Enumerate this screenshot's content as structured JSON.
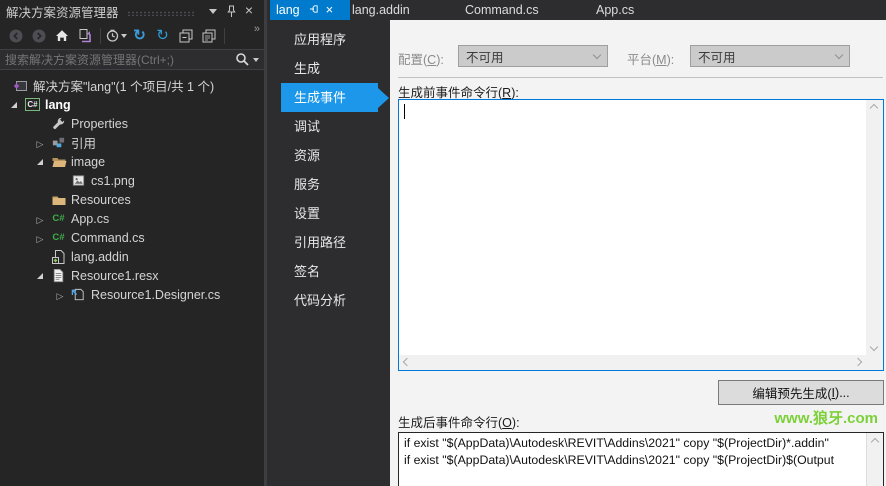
{
  "colors": {
    "active_tab_blue": "#007acc",
    "nav_selected_blue": "#1c97ea",
    "focus_border_blue": "#0078d7",
    "watermark_green": "#7cd038",
    "folder_tan": "#dcb67a",
    "csharp_green": "#3fae4a",
    "refresh_blue": "#3a9bd9",
    "sync_purple": "#b180d7"
  },
  "icons": {
    "csharp_glyph": "C#"
  },
  "tabs": [
    {
      "label": "lang",
      "active": true
    },
    {
      "label": "lang.addin",
      "active": false
    },
    {
      "label": "Command.cs",
      "active": false
    },
    {
      "label": "App.cs",
      "active": false
    }
  ],
  "solution_explorer": {
    "title": "解决方案资源管理器",
    "search_placeholder": "搜索解决方案资源管理器(Ctrl+;)",
    "overflow_glyph": "»",
    "tree": [
      {
        "label": "解决方案\"lang\"(1 个项目/共 1 个)",
        "icon": "solution",
        "expand": "none"
      },
      {
        "label": "lang",
        "icon": "csharp-project",
        "expand": "expanded"
      },
      {
        "label": "Properties",
        "icon": "wrench",
        "expand": "none"
      },
      {
        "label": "引用",
        "icon": "references",
        "expand": "collapsed"
      },
      {
        "label": "image",
        "icon": "folder-open",
        "expand": "expanded"
      },
      {
        "label": "cs1.png",
        "icon": "image",
        "expand": "none"
      },
      {
        "label": "Resources",
        "icon": "folder",
        "expand": "none"
      },
      {
        "label": "App.cs",
        "icon": "csharp-file",
        "expand": "collapsed"
      },
      {
        "label": "Command.cs",
        "icon": "csharp-file",
        "expand": "collapsed"
      },
      {
        "label": "lang.addin",
        "icon": "addin-file",
        "expand": "none"
      },
      {
        "label": "Resource1.resx",
        "icon": "resx-file",
        "expand": "expanded"
      },
      {
        "label": "Resource1.Designer.cs",
        "icon": "designer-file",
        "expand": "collapsed"
      }
    ]
  },
  "properties_page": {
    "nav": [
      {
        "label": "应用程序"
      },
      {
        "label": "生成"
      },
      {
        "label": "生成事件",
        "selected": true
      },
      {
        "label": "调试"
      },
      {
        "label": "资源"
      },
      {
        "label": "服务"
      },
      {
        "label": "设置"
      },
      {
        "label": "引用路径"
      },
      {
        "label": "签名"
      },
      {
        "label": "代码分析"
      }
    ],
    "config": {
      "label_before": "配置(",
      "label_key": "C",
      "label_after": "):",
      "value": "不可用",
      "disabled": true
    },
    "platform": {
      "label_before": "平台(",
      "label_key": "M",
      "label_after": "):",
      "value": "不可用",
      "disabled": true
    },
    "prebuild": {
      "label_before": "生成前事件命令行(",
      "label_key": "R",
      "label_after": "):",
      "value": ""
    },
    "edit_prebuild_button": {
      "label_before": "编辑预先生成(",
      "label_key": "I",
      "label_after": ")..."
    },
    "postbuild": {
      "label_before": "生成后事件命令行(",
      "label_key": "O",
      "label_after": "):",
      "line1": "if exist \"$(AppData)\\Autodesk\\REVIT\\Addins\\2021\" copy \"$(ProjectDir)*.addin\"",
      "line2": "if exist \"$(AppData)\\Autodesk\\REVIT\\Addins\\2021\" copy \"$(ProjectDir)$(Output"
    }
  },
  "watermark": {
    "text": "www.狼牙.com"
  }
}
